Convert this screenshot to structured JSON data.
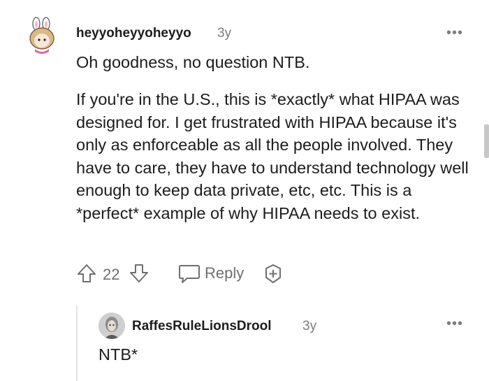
{
  "comment": {
    "avatar_icon": "bunny-avatar-icon",
    "username": "heyyoheyyoheyyo",
    "age": "3y",
    "more_label": "•••",
    "paragraphs": [
      "Oh goodness, no question NTB.",
      "If you're in the U.S., this is *exactly* what HIPAA was designed for. I get frustrated with HIPAA because it's only as enforceable as all the people involved. They have to care, they have to understand technology well enough to keep data private, etc, etc. This is a *perfect* example of why HIPAA needs to exist."
    ],
    "vote_count": "22",
    "reply_label": "Reply",
    "award_icon": "add-award-icon"
  },
  "reply": {
    "avatar_icon": "user-avatar-icon",
    "username": "RaffesRuleLionsDrool",
    "age": "3y",
    "more_label": "•••",
    "body": "NTB*"
  }
}
